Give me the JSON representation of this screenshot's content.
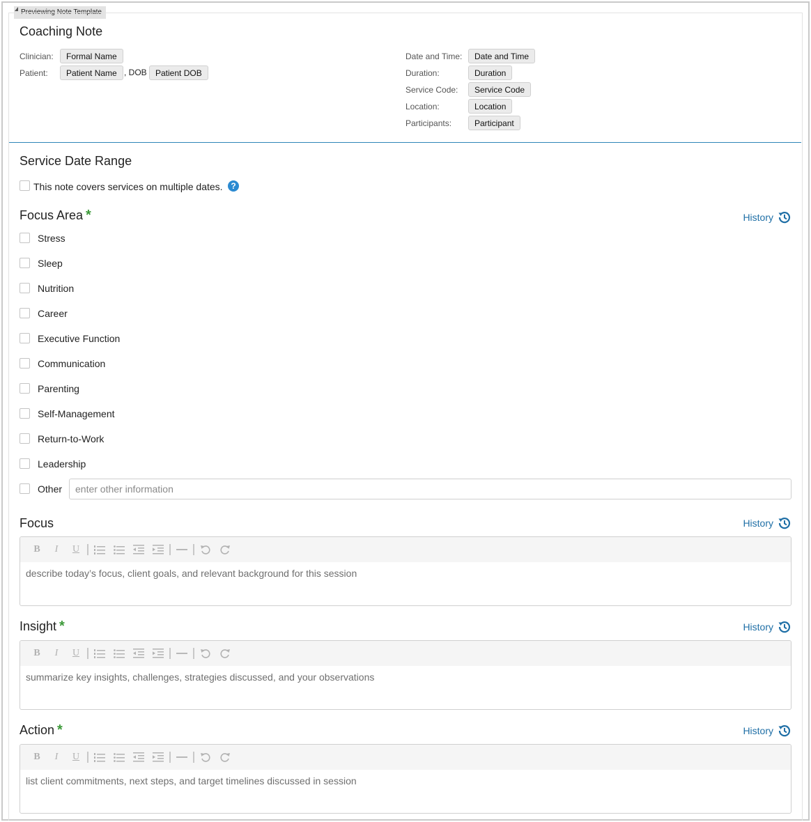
{
  "preview_tag": "Previewing Note Template",
  "note_title": "Coaching Note",
  "header": {
    "clinician_label": "Clinician:",
    "clinician_chip": "Formal Name",
    "patient_label": "Patient:",
    "patient_chip": "Patient Name",
    "dob_text": ", DOB",
    "dob_chip": "Patient DOB",
    "date_label": "Date and Time:",
    "date_chip": "Date and Time",
    "duration_label": "Duration:",
    "duration_chip": "Duration",
    "service_label": "Service Code:",
    "service_chip": "Service Code",
    "location_label": "Location:",
    "location_chip": "Location",
    "participants_label": "Participants:",
    "participants_chip": "Participant"
  },
  "service_date_range": {
    "title": "Service Date Range",
    "checkbox_label": "This note covers services on multiple dates.",
    "help_glyph": "?"
  },
  "history_label": "History",
  "required_mark": "*",
  "focus_area": {
    "title": "Focus Area",
    "options": [
      "Stress",
      "Sleep",
      "Nutrition",
      "Career",
      "Executive Function",
      "Communication",
      "Parenting",
      "Self-Management",
      "Return-to-Work",
      "Leadership"
    ],
    "other_label": "Other",
    "other_placeholder": "enter other information"
  },
  "focus": {
    "title": "Focus",
    "placeholder": "describe today’s focus, client goals, and relevant background for this session"
  },
  "insight": {
    "title": "Insight",
    "placeholder": "summarize key insights, challenges, strategies discussed, and your observations"
  },
  "action": {
    "title": "Action",
    "placeholder": "list client commitments, next steps, and target timelines discussed in session"
  },
  "colors": {
    "accent_blue": "#1f6fa6",
    "divider_blue": "#2f85b8",
    "required_green": "#3d9a3a",
    "help_blue": "#2b8ad1"
  }
}
